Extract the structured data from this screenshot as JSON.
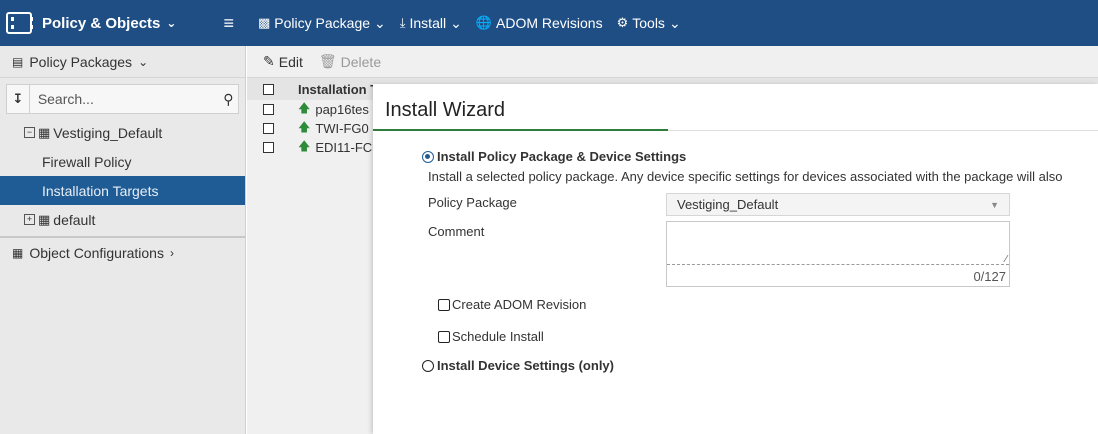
{
  "topbar": {
    "app_title": "Policy & Objects",
    "menu": [
      {
        "label": "Policy Package",
        "icon": "package-icon"
      },
      {
        "label": "Install",
        "icon": "install-icon"
      },
      {
        "label": "ADOM Revisions",
        "icon": "globe-icon"
      },
      {
        "label": "Tools",
        "icon": "gear-icon"
      }
    ],
    "bg_color": "#1f4e85"
  },
  "sidebar": {
    "header": "Policy Packages",
    "search_placeholder": "Search...",
    "tree": [
      {
        "label": "Vestiging_Default",
        "level": 0,
        "expanded": true
      },
      {
        "label": "Firewall Policy",
        "level": 1
      },
      {
        "label": "Installation Targets",
        "level": 1,
        "selected": true
      },
      {
        "label": "default",
        "level": 0,
        "expanded": false
      }
    ],
    "object_configurations": "Object Configurations"
  },
  "main": {
    "toolbar": {
      "edit": "Edit",
      "delete": "Delete"
    },
    "table_header": "Installation T",
    "rows": [
      "pap16tes",
      "TWI-FG0",
      "EDI11-FC"
    ]
  },
  "dialog": {
    "title": "Install Wizard",
    "option1": "Install Policy Package & Device Settings",
    "option1_desc": "Install a selected policy package. Any device specific settings for devices associated with the package will also",
    "policy_package_label": "Policy Package",
    "policy_package_value": "Vestiging_Default",
    "comment_label": "Comment",
    "comment_counter": "0/127",
    "create_revision": "Create ADOM Revision",
    "schedule_install": "Schedule Install",
    "option2": "Install Device Settings (only)"
  }
}
